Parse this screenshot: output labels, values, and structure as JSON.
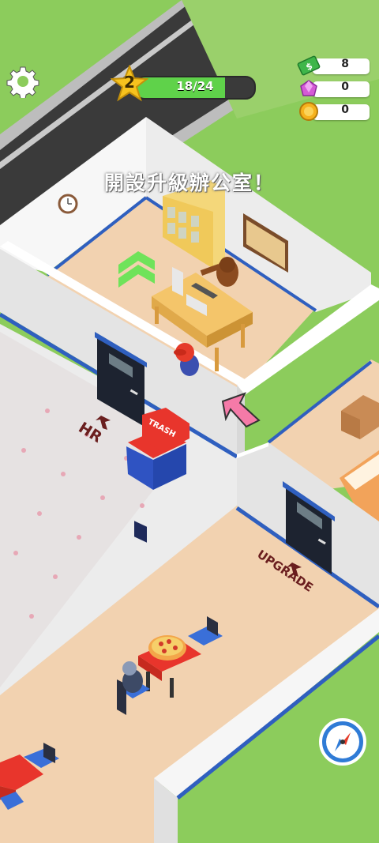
{
  "hud": {
    "level": "2",
    "progress_text": "18/24",
    "progress_fraction": 0.75,
    "cash": "8",
    "gems": "0",
    "tokens": "0"
  },
  "banner": {
    "text": "開設升級辦公室！"
  },
  "floor_labels": {
    "hr": "HR",
    "upgrade": "UPGRADE",
    "trash": "TRASH"
  },
  "icons": {
    "settings": "gear-icon",
    "cash": "cash-icon",
    "gem": "gem-icon",
    "token": "token-icon",
    "compass": "compass-icon"
  },
  "colors": {
    "progress_fill": "#5fd24a",
    "accent_blue": "#2f5fbf",
    "grass": "#8ccc5c"
  }
}
